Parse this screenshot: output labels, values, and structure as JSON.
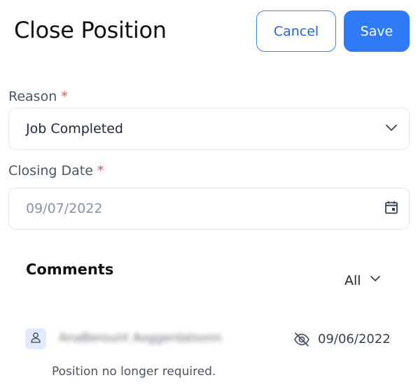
{
  "header": {
    "title": "Close Position",
    "cancel_label": "Cancel",
    "save_label": "Save"
  },
  "form": {
    "reason": {
      "label": "Reason",
      "required_mark": "*",
      "value": "Job Completed"
    },
    "closing_date": {
      "label": "Closing Date",
      "required_mark": "*",
      "value": "09/07/2022"
    }
  },
  "comments": {
    "title": "Comments",
    "filter_value": "All",
    "items": [
      {
        "author": "AnaBerount Aoggerdalsonn",
        "date": "09/06/2022",
        "text": "Position no longer required.",
        "icons": [
          "user-icon",
          "eye-off-icon"
        ]
      }
    ]
  },
  "colors": {
    "primary": "#2f7bf5",
    "required": "#e25555",
    "avatar_bg": "#e3e9ff",
    "border": "#e1e6f0"
  }
}
